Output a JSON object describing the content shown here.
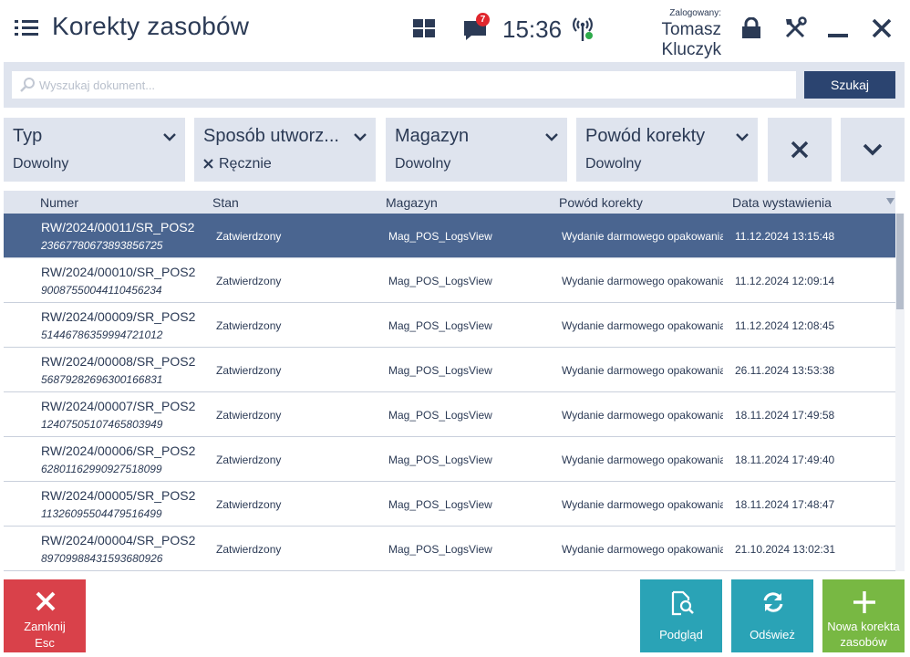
{
  "header": {
    "title": "Korekty zasobów",
    "notification_count": "7",
    "time": "15:36",
    "logged_label": "Zalogowany:",
    "user_name": "Tomasz Kluczyk"
  },
  "search": {
    "placeholder": "Wyszukaj dokument...",
    "value": "",
    "button_label": "Szukaj"
  },
  "filters": [
    {
      "label": "Typ",
      "value": "Dowolny"
    },
    {
      "label": "Sposób utworz...",
      "value": "Ręcznie"
    },
    {
      "label": "Magazyn",
      "value": "Dowolny"
    },
    {
      "label": "Powód korekty",
      "value": "Dowolny"
    }
  ],
  "table": {
    "columns": [
      "Numer",
      "Stan",
      "Magazyn",
      "Powód korekty",
      "Data wystawienia"
    ],
    "rows": [
      {
        "number": "RW/2024/00011/SR_POS2",
        "id": "2366778067389385672​5",
        "status": "Zatwierdzony",
        "warehouse": "Mag_POS_LogsView",
        "reason": "Wydanie darmowego opakowania",
        "date": "11.12.2024 13:15:48"
      },
      {
        "number": "RW/2024/00010/SR_POS2",
        "id": "90087550044110456234",
        "status": "Zatwierdzony",
        "warehouse": "Mag_POS_LogsView",
        "reason": "Wydanie darmowego opakowania",
        "date": "11.12.2024 12:09:14"
      },
      {
        "number": "RW/2024/00009/SR_POS2",
        "id": "51446786359994721012",
        "status": "Zatwierdzony",
        "warehouse": "Mag_POS_LogsView",
        "reason": "Wydanie darmowego opakowania",
        "date": "11.12.2024 12:08:45"
      },
      {
        "number": "RW/2024/00008/SR_POS2",
        "id": "56879282696300166831",
        "status": "Zatwierdzony",
        "warehouse": "Mag_POS_LogsView",
        "reason": "Wydanie darmowego opakowania",
        "date": "26.11.2024 13:53:38"
      },
      {
        "number": "RW/2024/00007/SR_POS2",
        "id": "12407505107465803949",
        "status": "Zatwierdzony",
        "warehouse": "Mag_POS_LogsView",
        "reason": "Wydanie darmowego opakowania",
        "date": "18.11.2024 17:49:58"
      },
      {
        "number": "RW/2024/00006/SR_POS2",
        "id": "62801162990927518099",
        "status": "Zatwierdzony",
        "warehouse": "Mag_POS_LogsView",
        "reason": "Wydanie darmowego opakowania",
        "date": "18.11.2024 17:49:40"
      },
      {
        "number": "RW/2024/00005/SR_POS2",
        "id": "11326095504479516499",
        "status": "Zatwierdzony",
        "warehouse": "Mag_POS_LogsView",
        "reason": "Wydanie darmowego opakowania",
        "date": "18.11.2024 17:48:47"
      },
      {
        "number": "RW/2024/00004/SR_POS2",
        "id": "89709988431593680926",
        "status": "Zatwierdzony",
        "warehouse": "Mag_POS_LogsView",
        "reason": "Wydanie darmowego opakowania",
        "date": "21.10.2024 13:02:31"
      }
    ]
  },
  "buttons": {
    "close_line1": "Zamknij",
    "close_line2": "Esc",
    "preview": "Podgląd",
    "refresh": "Odśwież",
    "new_line1": "Nowa korekta",
    "new_line2": "zasobów"
  },
  "colors": {
    "primary_dark": "#2b3a55",
    "panel": "#dfe4ee",
    "search_button": "#2b4470",
    "selected_row": "#4a6590",
    "close_button": "#d9414a",
    "action_button": "#2aa3b6",
    "new_button": "#78b843",
    "badge": "#e0262d"
  },
  "icons": [
    "menu-icon",
    "tiles-icon",
    "message-icon",
    "signal-icon",
    "lock-icon",
    "tools-icon",
    "minimize-icon",
    "close-icon",
    "search-icon",
    "chevron-down-icon",
    "clear-filters-icon",
    "expand-filters-icon",
    "sort-icon",
    "preview-icon",
    "refresh-icon",
    "plus-icon"
  ]
}
